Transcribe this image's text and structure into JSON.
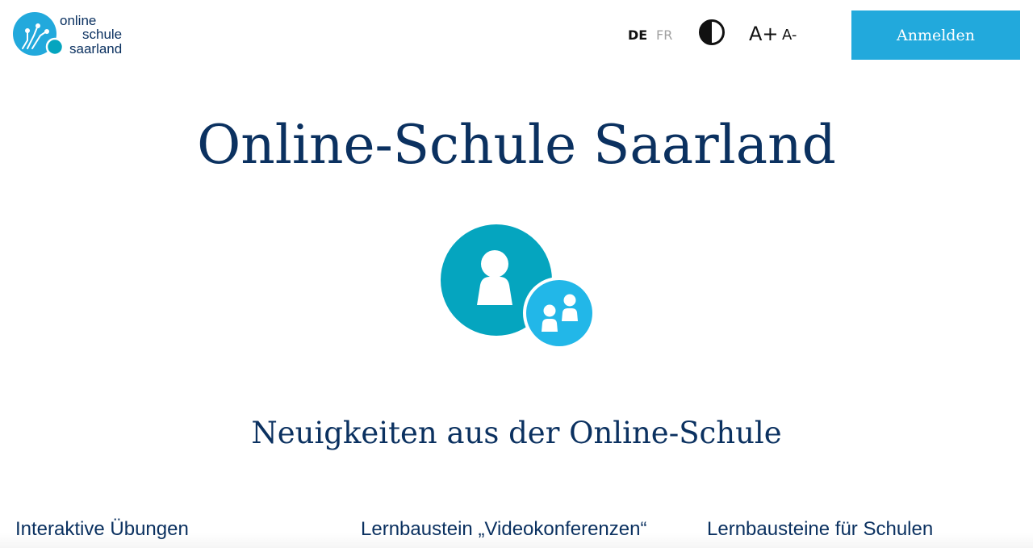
{
  "colors": {
    "brand_blue": "#22a9dc",
    "navy": "#0b3160",
    "teal": "#05a5bf",
    "light_blue": "#22b7e8"
  },
  "header": {
    "logo": {
      "line1": "online",
      "line2": "schule",
      "line3": "saarland"
    },
    "languages": {
      "de": "DE",
      "fr": "FR",
      "active": "DE"
    },
    "contrast_icon": "contrast-icon",
    "font_increase": "A+",
    "font_decrease": "A-",
    "login_label": "Anmelden"
  },
  "hero": {
    "title": "Online-Schule Saarland",
    "icon": "teacher-students-icon"
  },
  "news": {
    "heading": "Neuigkeiten aus der Online-Schule",
    "items": [
      {
        "title": "Interaktive Übungen"
      },
      {
        "title": "Lernbaustein „Videokonferenzen“"
      },
      {
        "title": "Lernbausteine für Schulen"
      }
    ]
  }
}
